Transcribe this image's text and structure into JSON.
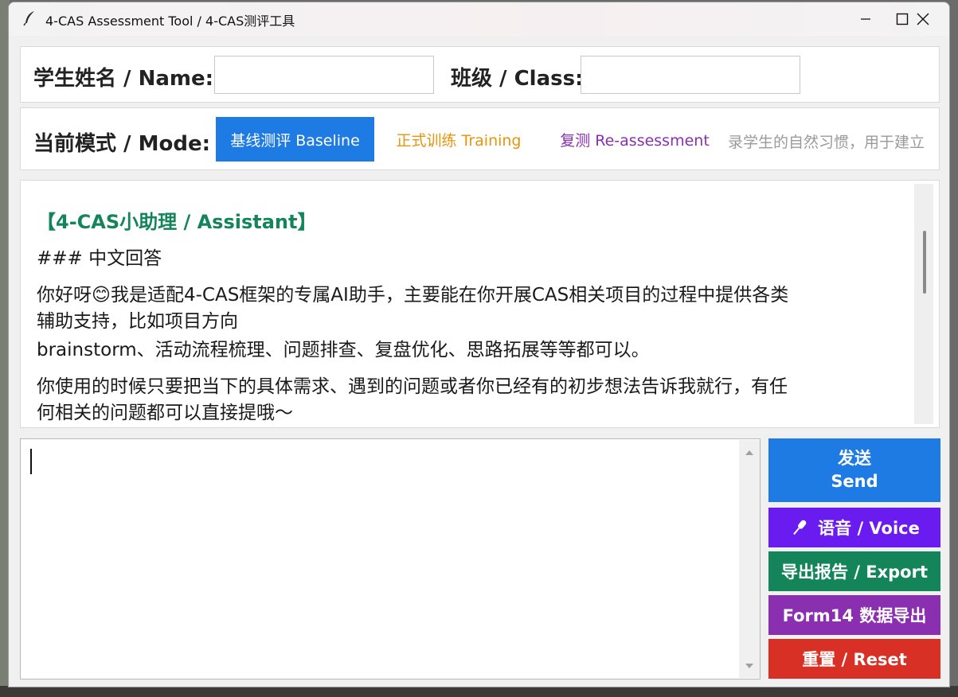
{
  "window": {
    "title": "4-CAS Assessment Tool / 4-CAS测评工具"
  },
  "student": {
    "name_label": "学生姓名 / Name:",
    "name_value": "",
    "class_label": "班级 / Class:",
    "class_value": ""
  },
  "mode": {
    "label": "当前模式 / Mode:",
    "options": [
      {
        "label": "基线测评 Baseline",
        "color": "#ffffff",
        "active": true
      },
      {
        "label": "正式训练 Training",
        "color": "#e8940c",
        "active": false
      },
      {
        "label": "复测 Re-assessment",
        "color": "#8a2fb0",
        "active": false
      }
    ],
    "hint": "录学生的自然习惯，用于建立"
  },
  "chat": {
    "assistant_tag": "【4-CAS小助理 / Assistant】",
    "lines": [
      "### 中文回答",
      "你好呀😊我是适配4-CAS框架的专属AI助手，主要能在你开展CAS相关项目的过程中提供各类",
      "辅助支持，比如项目方向",
      "brainstorm、活动流程梳理、问题排查、复盘优化、思路拓展等等都可以。",
      "你使用的时候只要把当下的具体需求、遇到的问题或者你已经有的初步想法告诉我就行，有任",
      "何相关的问题都可以直接提哦～"
    ]
  },
  "input": {
    "value": ""
  },
  "actions": {
    "send": {
      "line1": "发送",
      "line2": "Send",
      "color": "#1e7be3"
    },
    "voice": {
      "label": "语音 / Voice",
      "icon": "microphone-icon",
      "color": "#6a1bf0"
    },
    "export": {
      "label": "导出报告 / Export",
      "color": "#14855a"
    },
    "form14": {
      "label": "Form14 数据导出",
      "color": "#8a2fb0"
    },
    "reset": {
      "label": "重置 / Reset",
      "color": "#d93025"
    }
  }
}
